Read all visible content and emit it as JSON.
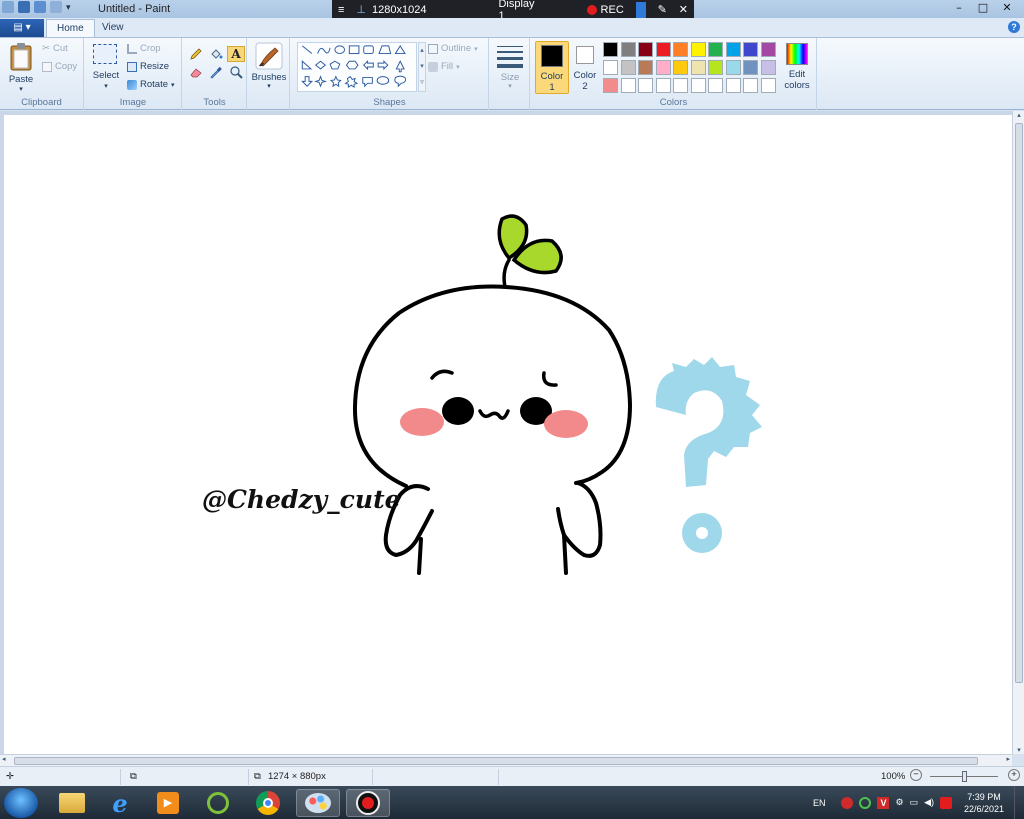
{
  "window": {
    "title": "Untitled - Paint",
    "controls": {
      "minimize": "–",
      "maximize": "□",
      "close": "✕"
    }
  },
  "recorder": {
    "resolution": "1280x1024",
    "display": "Display 1",
    "rec_label": "REC",
    "rec_color": "#e31d1d"
  },
  "tabs": {
    "file": "▤ ▾",
    "home": "Home",
    "view": "View",
    "help": "?"
  },
  "ribbon": {
    "clipboard": {
      "label": "Clipboard",
      "paste": "Paste",
      "cut": "Cut",
      "copy": "Copy"
    },
    "image": {
      "label": "Image",
      "select": "Select",
      "crop": "Crop",
      "resize": "Resize",
      "rotate": "Rotate"
    },
    "tools": {
      "label": "Tools"
    },
    "brushes": {
      "label": "Brushes"
    },
    "shapes": {
      "label": "Shapes",
      "outline": "Outline",
      "fill": "Fill"
    },
    "size": {
      "label": "Size"
    },
    "colors": {
      "label": "Colors",
      "color1": "Color",
      "color1_num": "1",
      "color2": "Color",
      "color2_num": "2",
      "edit_colors": "Edit",
      "edit_colors2": "colors",
      "color1_value": "#000000",
      "color2_value": "#ffffff",
      "palette_row1": [
        "#000000",
        "#7f7f7f",
        "#880015",
        "#ed1c24",
        "#ff7f27",
        "#fff200",
        "#22b14c",
        "#00a2e8",
        "#3f48cc",
        "#a349a4"
      ],
      "palette_row2": [
        "#ffffff",
        "#c3c3c3",
        "#b97a57",
        "#ffaec9",
        "#ffc90e",
        "#efe4b0",
        "#b5e61d",
        "#99d9ea",
        "#7092be",
        "#c8bfe7"
      ],
      "palette_row3": [
        "#f28b8b",
        "#ffffff",
        "#ffffff",
        "#ffffff",
        "#ffffff",
        "#ffffff",
        "#ffffff",
        "#ffffff",
        "#ffffff",
        "#ffffff"
      ]
    }
  },
  "canvas": {
    "signature": "@Chedzy_cute",
    "leaf_color": "#a7d82b",
    "blush_color": "#f2898a",
    "question_color": "#9ed8ea"
  },
  "status": {
    "image_size": "1274 × 880px",
    "zoom": "100%"
  },
  "taskbar": {
    "language": "EN",
    "time": "7:39 PM",
    "date": "22/6/2021"
  }
}
